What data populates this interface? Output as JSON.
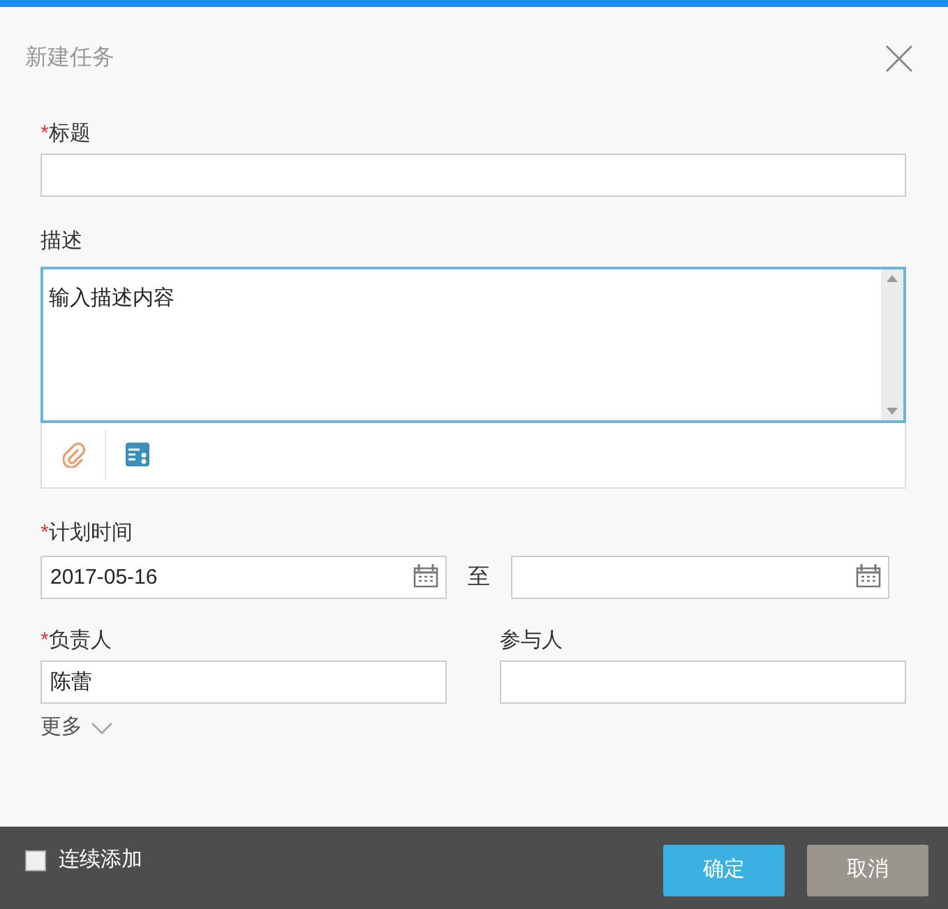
{
  "dialog": {
    "title": "新建任务"
  },
  "title_field": {
    "mark": "*",
    "label": "标题"
  },
  "description": {
    "label": "描述",
    "placeholder": "输入描述内容"
  },
  "plan_time": {
    "mark": "*",
    "label": "计划时间",
    "start": "2017-05-16",
    "separator": "至"
  },
  "owner": {
    "mark": "*",
    "label": "负责人",
    "value": "陈蕾"
  },
  "participants": {
    "label": "参与人"
  },
  "more": {
    "label": "更多",
    "expanded": false
  },
  "footer": {
    "continuous_add": {
      "label": "连续添加",
      "checked": false
    },
    "buttons": [
      {
        "label": "确定",
        "kind": "primary"
      },
      {
        "label": "取消",
        "kind": "secondary"
      }
    ]
  }
}
